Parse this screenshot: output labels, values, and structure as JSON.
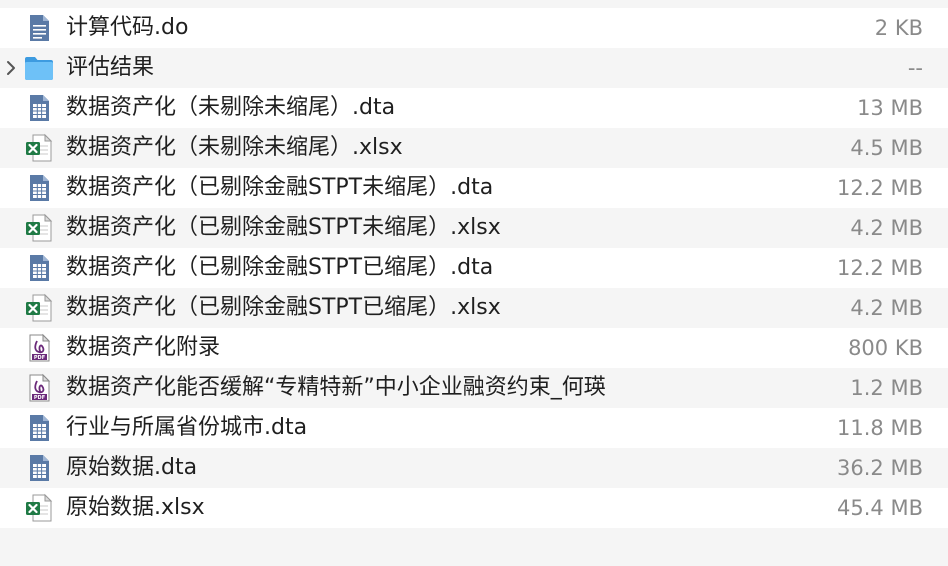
{
  "files": [
    {
      "name": "计算代码.do",
      "size": "2 KB",
      "icon": "document-icon"
    },
    {
      "name": "评估结果",
      "size": "--",
      "icon": "folder-icon",
      "expandable": true
    },
    {
      "name": "数据资产化（未剔除未缩尾）.dta",
      "size": "13 MB",
      "icon": "dta-icon"
    },
    {
      "name": "数据资产化（未剔除未缩尾）.xlsx",
      "size": "4.5 MB",
      "icon": "excel-icon"
    },
    {
      "name": "数据资产化（已剔除金融STPT未缩尾）.dta",
      "size": "12.2 MB",
      "icon": "dta-icon"
    },
    {
      "name": "数据资产化（已剔除金融STPT未缩尾）.xlsx",
      "size": "4.2 MB",
      "icon": "excel-icon"
    },
    {
      "name": "数据资产化（已剔除金融STPT已缩尾）.dta",
      "size": "12.2 MB",
      "icon": "dta-icon"
    },
    {
      "name": "数据资产化（已剔除金融STPT已缩尾）.xlsx",
      "size": "4.2 MB",
      "icon": "excel-icon"
    },
    {
      "name": "数据资产化附录",
      "size": "800 KB",
      "icon": "pdf-icon"
    },
    {
      "name": "数据资产化能否缓解“专精特新”中小企业融资约束_何瑛",
      "size": "1.2 MB",
      "icon": "pdf-icon"
    },
    {
      "name": "行业与所属省份城市.dta",
      "size": "11.8 MB",
      "icon": "dta-icon"
    },
    {
      "name": "原始数据.dta",
      "size": "36.2 MB",
      "icon": "dta-icon"
    },
    {
      "name": "原始数据.xlsx",
      "size": "45.4 MB",
      "icon": "excel-icon"
    }
  ],
  "colors": {
    "row_even": "#ffffff",
    "row_odd": "#f5f5f5",
    "name_text": "#1f1f1f",
    "size_text": "#8a8a8a",
    "folder": "#56b1f0",
    "excel": "#1f7a45",
    "pdf": "#6b2a7a",
    "doc": "#4f6f9a"
  }
}
